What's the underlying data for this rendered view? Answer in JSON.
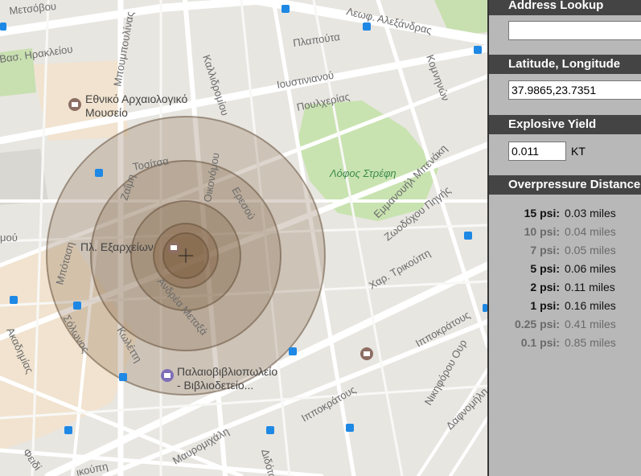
{
  "map": {
    "streets": {
      "metsovou": "Μετσόβου",
      "leof_alexandras": "Λεωφ. Αλεξάνδρας",
      "vas_irakleiou": "Βασ. Ηρακλείου",
      "mpoumpoulinas": "Μπουμπουλίνας",
      "kallidromiou": "Καλλιδρομίου",
      "plapouta": "Πλαπούτα",
      "ioustinianou": "Ιουστινιανού",
      "poulcherias": "Πουλχερίας",
      "komninon": "Κομνηνών",
      "tositsa": "Τοσίτσα",
      "zaimi": "Ζαΐμη",
      "oikonomou": "Οικονόμου",
      "eressou": "Ερεσού",
      "emmanouil_benaki": "Εμμανουήλ Μπενάκη",
      "zoodochou_pigis": "Ζωοδόχου Πηγής",
      "char_trikoupi": "Χαρ. Τρικούπη",
      "mpotasi": "Μπόταση",
      "solonos": "Σόλωνος",
      "koletti": "Κωλέττη",
      "akadimias": "Ακαδημίας",
      "ippokratous_1": "Ιπποκράτους",
      "ippokratous_2": "Ιπποκράτους",
      "nikiforou": "Νικηφόρου Ουρ",
      "dafnomili": "Δαφνομήλη",
      "mavromichali": "Μαυρομιχάλη",
      "didotou": "Διδότου",
      "feidiou": "Φειδί",
      "trikoupi_bottom": "ικούπη",
      "apollonos": "μού",
      "themistokleous": "Ανδρέα Μεταξά"
    },
    "poi": {
      "museum_line1": "Εθνικό Αρχαιολογικό",
      "museum_line2": "Μουσείο",
      "exarcheia": "Πλ. Εξαρχείων",
      "bookshop_line1": "Παλαιοβιβλιοπωλείο",
      "bookshop_line2": "- Βιβλιοδετείο..."
    },
    "park": "Λόφος Στρέφη",
    "blast_color": "#7a5a3a"
  },
  "panel": {
    "address_lookup": {
      "heading": "Address Lookup",
      "value": ""
    },
    "latlng": {
      "heading": "Latitude, Longitude",
      "value": "37.9865,23.7351"
    },
    "yield": {
      "heading": "Explosive Yield",
      "value": "0.011",
      "unit": "KT"
    },
    "overpressure": {
      "heading": "Overpressure Distance",
      "rows": [
        {
          "label": "15 psi:",
          "value": "0.03 miles",
          "style": "dark"
        },
        {
          "label": "10 psi:",
          "value": "0.04 miles",
          "style": "light"
        },
        {
          "label": "7 psi:",
          "value": "0.05 miles",
          "style": "light"
        },
        {
          "label": "5 psi:",
          "value": "0.06 miles",
          "style": "dark"
        },
        {
          "label": "2 psi:",
          "value": "0.11 miles",
          "style": "dark"
        },
        {
          "label": "1 psi:",
          "value": "0.16 miles",
          "style": "dark"
        },
        {
          "label": "0.25 psi:",
          "value": "0.41 miles",
          "style": "light"
        },
        {
          "label": "0.1 psi:",
          "value": "0.85 miles",
          "style": "light"
        }
      ]
    }
  }
}
